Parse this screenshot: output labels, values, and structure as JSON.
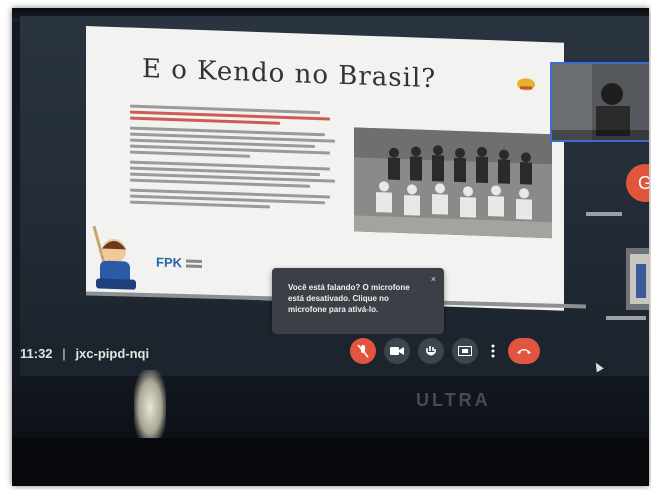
{
  "slide": {
    "title": "E o Kendo no Brasil?",
    "logo_text": "FPK"
  },
  "participants": {
    "avatar_letter": "G",
    "avatar_color": "#e0563a"
  },
  "tooltip": {
    "message": "Você está falando? O microfone está desativado. Clique no microfone para ativá-lo.",
    "close": "×"
  },
  "toolbar": {
    "time": "11:32",
    "separator": "|",
    "meeting_code": "jxc-pipd-nqi",
    "mic_icon": "mic-off-icon",
    "camera_icon": "camera-icon",
    "hand_icon": "raise-hand-icon",
    "present_icon": "present-icon",
    "more_icon": "more-options-icon",
    "end_icon": "end-call-icon"
  },
  "room": {
    "monitor_brand": "ULTRA"
  }
}
